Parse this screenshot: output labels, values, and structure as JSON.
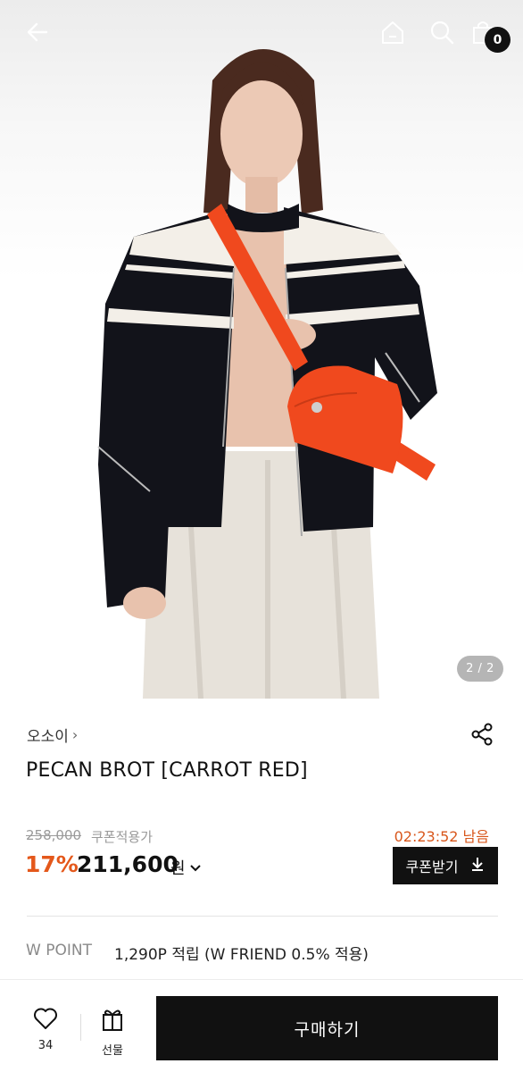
{
  "header": {
    "cart_count": "0",
    "icons": [
      "back-arrow-icon",
      "home-icon",
      "search-icon",
      "shopping-bag-icon"
    ]
  },
  "gallery": {
    "counter": "2 / 2"
  },
  "product": {
    "brand": "오소이",
    "title": "PECAN BROT [CARROT RED]",
    "original_price": "258,000",
    "coupon_price_label": "쿠폰적용가",
    "discount": "17%",
    "sale_price": "211,600",
    "currency": "원",
    "timer": "02:23:52 남음",
    "coupon_button": "쿠폰받기"
  },
  "points": {
    "label": "W POINT",
    "value": "1,290P 적립 (W FRIEND 0.5% 적용)"
  },
  "bottom_bar": {
    "like_count": "34",
    "gift_label": "선물",
    "buy_label": "구매하기"
  },
  "colors": {
    "accent_orange": "#e4581b",
    "bag_orange": "#f0491e",
    "primary_black": "#111111"
  }
}
